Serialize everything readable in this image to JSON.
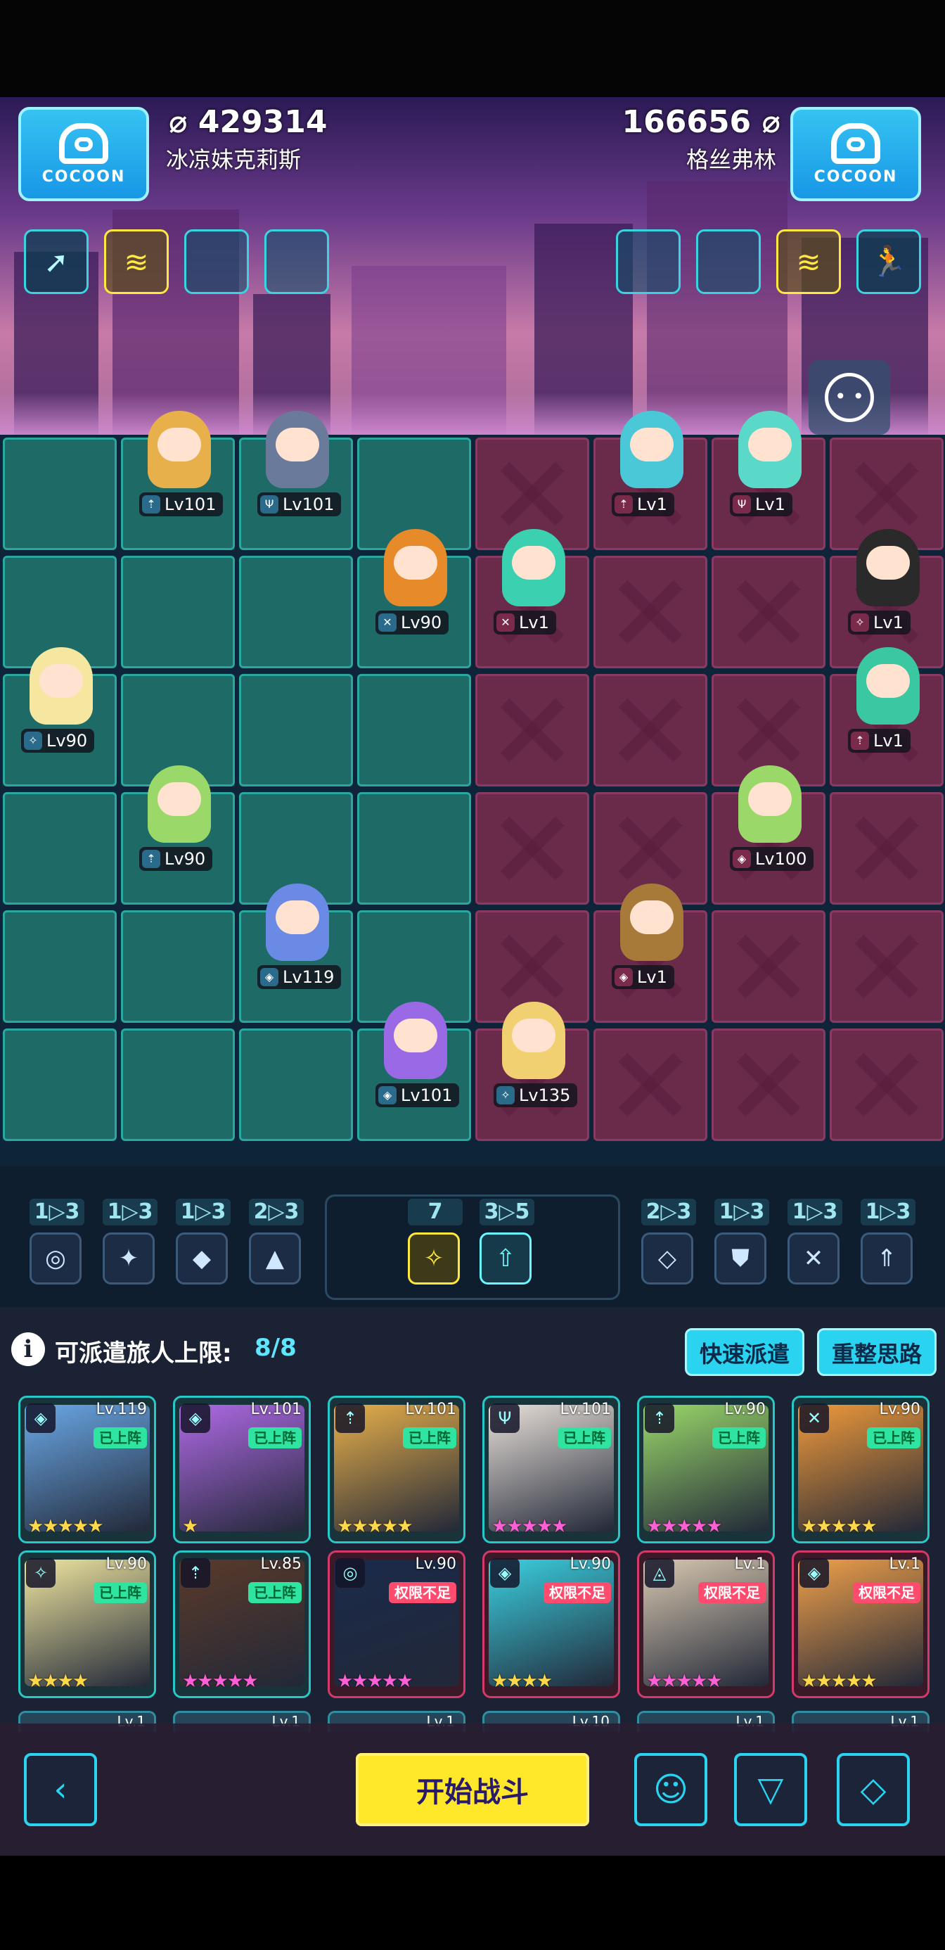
{
  "colors": {
    "ally_tile": "#1d6a66",
    "enemy_tile": "#6a2a4a",
    "accent": "#2ad3ef",
    "start_button": "#ffe829"
  },
  "player_left": {
    "logo_text": "COCOON",
    "score": "429314",
    "name": "冰凉妹克莉斯",
    "skills": [
      "arrow-burst-icon",
      "wave-glyph-icon",
      "",
      ""
    ]
  },
  "player_right": {
    "logo_text": "COCOON",
    "score": "166656",
    "name": "格丝弗林",
    "skills": [
      "",
      "",
      "wave-glyph-icon",
      "runner-icon"
    ]
  },
  "board": {
    "allies": [
      {
        "level": "Lv101",
        "color": "#e8b04a"
      },
      {
        "level": "Lv101",
        "color": "#6a7a9a"
      },
      {
        "level": "Lv90",
        "color": "#e68a2a"
      },
      {
        "level": "Lv90",
        "color": "#f5e6a0"
      },
      {
        "level": "Lv90",
        "color": "#9ad86a"
      },
      {
        "level": "Lv119",
        "color": "#6a8ae6"
      },
      {
        "level": "Lv101",
        "color": "#9a6ae6"
      },
      {
        "level": "Lv135",
        "color": "#f0d070"
      }
    ],
    "enemies": [
      {
        "level": "Lv1",
        "color": "#4ac8d8"
      },
      {
        "level": "Lv1",
        "color": "#5ad8c8"
      },
      {
        "level": "Lv1",
        "color": "#3ad0b0"
      },
      {
        "level": "Lv1",
        "color": "#2a2a2a"
      },
      {
        "level": "Lv1",
        "color": "#3ac8a0"
      },
      {
        "level": "Lv100",
        "color": "#9ad86a"
      },
      {
        "level": "Lv1",
        "color": "#a87a3a"
      }
    ]
  },
  "synergies": [
    {
      "count": "1▷3",
      "icon": "swirl-icon"
    },
    {
      "count": "1▷3",
      "icon": "star-blade-icon"
    },
    {
      "count": "1▷3",
      "icon": "shard-icon"
    },
    {
      "count": "2▷3",
      "icon": "mountain-icon"
    },
    {
      "count": "7",
      "icon": "sparkle-icon"
    },
    {
      "count": "3▷5",
      "icon": "up-arrow-icon"
    },
    {
      "count": "2▷3",
      "icon": "diamond-icon"
    },
    {
      "count": "1▷3",
      "icon": "shield-icon"
    },
    {
      "count": "1▷3",
      "icon": "crossed-swords-icon"
    },
    {
      "count": "1▷3",
      "icon": "arrow-up-icon"
    }
  ],
  "roster": {
    "limit_label": "可派遣旅人上限:",
    "limit_value": "8/8",
    "quick_dispatch": "快速派遣",
    "reset": "重整思路",
    "cards": [
      {
        "level": "Lv.119",
        "tag": "已上阵",
        "stars": "★★★★★",
        "color": "#6aa8e6"
      },
      {
        "level": "Lv.101",
        "tag": "已上阵",
        "stars": "★",
        "color": "#b06ae6"
      },
      {
        "level": "Lv.101",
        "tag": "已上阵",
        "stars": "★★★★★",
        "color": "#e8b04a"
      },
      {
        "level": "Lv.101",
        "tag": "已上阵",
        "stars": "★★★★★",
        "color": "#e8e0d8"
      },
      {
        "level": "Lv.90",
        "tag": "已上阵",
        "stars": "★★★★★",
        "color": "#9ad86a"
      },
      {
        "level": "Lv.90",
        "tag": "已上阵",
        "stars": "★★★★★",
        "color": "#f09a3a"
      },
      {
        "level": "Lv.90",
        "tag": "已上阵",
        "stars": "★★★★",
        "color": "#f0e6a0"
      },
      {
        "level": "Lv.85",
        "tag": "已上阵",
        "stars": "★★★★★",
        "color": "#5a3a2a"
      },
      {
        "level": "Lv.90",
        "tag": "权限不足",
        "stars": "★★★★★",
        "color": "#1a2a4a"
      },
      {
        "level": "Lv.90",
        "tag": "权限不足",
        "stars": "★★★★",
        "color": "#3ad0e0"
      },
      {
        "level": "Lv.1",
        "tag": "权限不足",
        "stars": "★★★★★",
        "color": "#d8c8b0"
      },
      {
        "level": "Lv.1",
        "tag": "权限不足",
        "stars": "★★★★★",
        "color": "#f0a04a"
      }
    ],
    "partial_levels": [
      "Lv.1",
      "Lv.1",
      "Lv.1",
      "Lv.10",
      "Lv.1",
      "Lv.1"
    ]
  },
  "actions": {
    "back": "‹",
    "start": "开始战斗",
    "brain": "brain-icon",
    "filter": "filter-icon",
    "sort": "sort-icon"
  }
}
